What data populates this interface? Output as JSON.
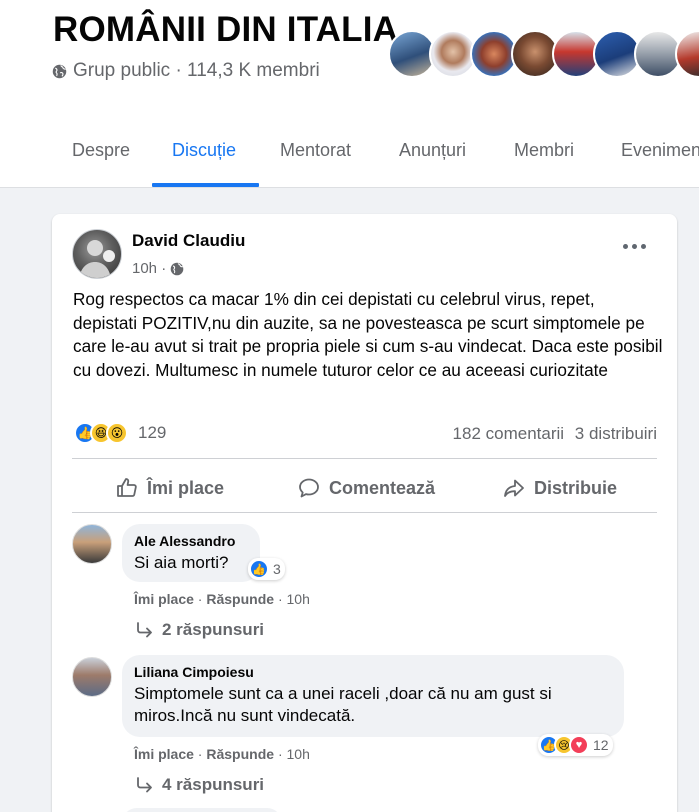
{
  "group": {
    "title": "ROMÂNII DIN ITALIA",
    "meta": "Grup public · 114,3 K membri",
    "icon": "globe-icon"
  },
  "tabs": [
    {
      "label": "Despre",
      "active": false
    },
    {
      "label": "Discuție",
      "active": true
    },
    {
      "label": "Mentorat",
      "active": false
    },
    {
      "label": "Anunțuri",
      "active": false
    },
    {
      "label": "Membri",
      "active": false
    },
    {
      "label": "Evenimente",
      "active": false
    }
  ],
  "post": {
    "author": "David Claudiu",
    "time": "10h ·",
    "text": "Rog respectos ca macar 1% din cei depistati cu celebrul virus, repet, depistati POZITIV,nu din auzite,  sa ne povesteasca pe scurt simptomele pe care le-au avut si trait pe propria piele si cum s-au vindecat. Daca este posibil cu dovezi. Multumesc in numele tuturor celor ce au aceeasi curiozitate",
    "reaction_count": "129",
    "comments_count": "182 comentarii",
    "shares_count": "3 distribuiri",
    "actions": {
      "like": "Îmi place",
      "comment": "Comentează",
      "share": "Distribuie"
    }
  },
  "comments": [
    {
      "author": "Ale Alessandro",
      "text": "Si aia morti?",
      "reaction_count": "3",
      "like": "Îmi place",
      "reply": "Răspunde",
      "time": "10h",
      "replies": "2 răspunsuri"
    },
    {
      "author": "Liliana Cimpoiesu",
      "text": "Simptomele sunt ca a unei raceli ,doar că nu am gust si miros.Incă nu sunt vindecată.",
      "reaction_count": "12",
      "like": "Îmi place",
      "reply": "Răspunde",
      "time": "10h",
      "replies": "4 răspunsuri"
    }
  ],
  "colors": {
    "accent": "#1877f2",
    "secondary_text": "#65676b",
    "background": "#f0f2f5"
  }
}
